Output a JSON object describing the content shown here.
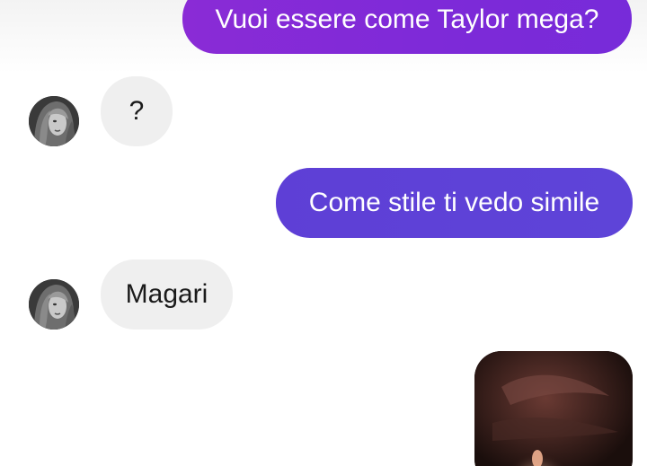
{
  "conversation": {
    "messages": [
      {
        "direction": "sent",
        "text": "Vuoi essere come Taylor mega?"
      },
      {
        "direction": "received",
        "text": "?"
      },
      {
        "direction": "sent",
        "text": "Come stile ti vedo simile"
      },
      {
        "direction": "received",
        "text": "Magari"
      },
      {
        "direction": "sent",
        "type": "photo"
      }
    ]
  },
  "colors": {
    "sent_bubble_top": "#8a2bd6",
    "sent_bubble_bottom": "#5e44d8",
    "received_bubble": "#efefef",
    "background": "#ffffff"
  }
}
